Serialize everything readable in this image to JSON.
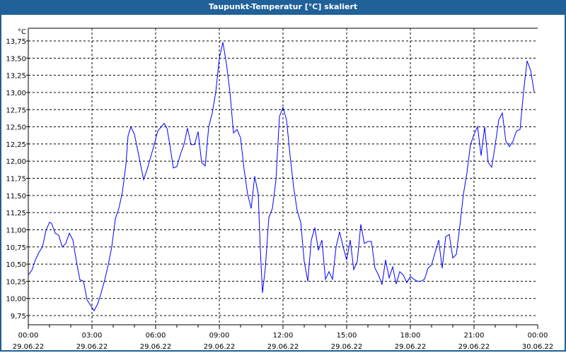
{
  "window": {
    "title": "Taupunkt-Temperatur [°C] skaliert"
  },
  "chart_data": {
    "type": "line",
    "title": "Taupunkt-Temperatur [°C] skaliert",
    "ylabel": "°C",
    "xlabel": "",
    "ylim": [
      9.625,
      13.9
    ],
    "xlim_minutes": [
      0,
      1440
    ],
    "grid": true,
    "line_color": "#0000ff",
    "yticks": [
      {
        "value": 9.75,
        "label": "9,75"
      },
      {
        "value": 10.0,
        "label": "10,00"
      },
      {
        "value": 10.25,
        "label": "10,25"
      },
      {
        "value": 10.5,
        "label": "10,50"
      },
      {
        "value": 10.75,
        "label": "10,75"
      },
      {
        "value": 11.0,
        "label": "11,00"
      },
      {
        "value": 11.25,
        "label": "11,25"
      },
      {
        "value": 11.5,
        "label": "11,50"
      },
      {
        "value": 11.75,
        "label": "11,75"
      },
      {
        "value": 12.0,
        "label": "12,00"
      },
      {
        "value": 12.25,
        "label": "12,25"
      },
      {
        "value": 12.5,
        "label": "12,50"
      },
      {
        "value": 12.75,
        "label": "12,75"
      },
      {
        "value": 13.0,
        "label": "13,00"
      },
      {
        "value": 13.25,
        "label": "13,25"
      },
      {
        "value": 13.5,
        "label": "13,50"
      },
      {
        "value": 13.75,
        "label": "13,75"
      }
    ],
    "xticks": [
      {
        "minutes": 0,
        "time": "00:00",
        "date": "29.06.22"
      },
      {
        "minutes": 180,
        "time": "03:00",
        "date": "29.06.22"
      },
      {
        "minutes": 360,
        "time": "06:00",
        "date": "29.06.22"
      },
      {
        "minutes": 540,
        "time": "09:00",
        "date": "29.06.22"
      },
      {
        "minutes": 720,
        "time": "12:00",
        "date": "29.06.22"
      },
      {
        "minutes": 900,
        "time": "15:00",
        "date": "29.06.22"
      },
      {
        "minutes": 1080,
        "time": "18:00",
        "date": "29.06.22"
      },
      {
        "minutes": 1260,
        "time": "21:00",
        "date": "29.06.22"
      },
      {
        "minutes": 1440,
        "time": "00:00",
        "date": "30.06.22"
      }
    ],
    "series": [
      {
        "name": "Taupunkt",
        "points": [
          [
            0,
            10.34
          ],
          [
            10,
            10.41
          ],
          [
            20,
            10.56
          ],
          [
            30,
            10.67
          ],
          [
            40,
            10.75
          ],
          [
            50,
            10.99
          ],
          [
            60,
            11.11
          ],
          [
            66,
            11.09
          ],
          [
            76,
            10.95
          ],
          [
            86,
            10.92
          ],
          [
            96,
            10.75
          ],
          [
            106,
            10.8
          ],
          [
            116,
            10.95
          ],
          [
            126,
            10.85
          ],
          [
            136,
            10.54
          ],
          [
            146,
            10.27
          ],
          [
            156,
            10.25
          ],
          [
            166,
            9.98
          ],
          [
            176,
            9.9
          ],
          [
            186,
            9.82
          ],
          [
            196,
            9.92
          ],
          [
            206,
            10.08
          ],
          [
            216,
            10.27
          ],
          [
            226,
            10.49
          ],
          [
            236,
            10.75
          ],
          [
            246,
            11.16
          ],
          [
            256,
            11.31
          ],
          [
            266,
            11.55
          ],
          [
            276,
            11.95
          ],
          [
            282,
            12.37
          ],
          [
            290,
            12.5
          ],
          [
            300,
            12.39
          ],
          [
            310,
            12.14
          ],
          [
            320,
            11.88
          ],
          [
            326,
            11.73
          ],
          [
            336,
            11.88
          ],
          [
            346,
            12.06
          ],
          [
            356,
            12.24
          ],
          [
            366,
            12.44
          ],
          [
            376,
            12.5
          ],
          [
            384,
            12.55
          ],
          [
            392,
            12.48
          ],
          [
            400,
            12.24
          ],
          [
            410,
            11.9
          ],
          [
            420,
            11.92
          ],
          [
            430,
            12.1
          ],
          [
            440,
            12.24
          ],
          [
            450,
            12.48
          ],
          [
            460,
            12.24
          ],
          [
            470,
            12.24
          ],
          [
            480,
            12.43
          ],
          [
            490,
            11.98
          ],
          [
            500,
            11.93
          ],
          [
            510,
            12.5
          ],
          [
            520,
            12.7
          ],
          [
            530,
            13.01
          ],
          [
            540,
            13.5
          ],
          [
            550,
            13.73
          ],
          [
            560,
            13.42
          ],
          [
            570,
            13.01
          ],
          [
            580,
            12.41
          ],
          [
            590,
            12.46
          ],
          [
            600,
            12.34
          ],
          [
            610,
            11.88
          ],
          [
            620,
            11.52
          ],
          [
            630,
            11.31
          ],
          [
            640,
            11.78
          ],
          [
            650,
            11.52
          ],
          [
            656,
            10.7
          ],
          [
            662,
            10.08
          ],
          [
            670,
            10.44
          ],
          [
            680,
            11.18
          ],
          [
            690,
            11.31
          ],
          [
            700,
            11.72
          ],
          [
            710,
            12.65
          ],
          [
            720,
            12.78
          ],
          [
            730,
            12.6
          ],
          [
            740,
            12.08
          ],
          [
            750,
            11.62
          ],
          [
            760,
            11.28
          ],
          [
            770,
            11.11
          ],
          [
            780,
            10.54
          ],
          [
            790,
            10.25
          ],
          [
            800,
            10.85
          ],
          [
            810,
            11.03
          ],
          [
            820,
            10.7
          ],
          [
            830,
            10.85
          ],
          [
            840,
            10.28
          ],
          [
            850,
            10.39
          ],
          [
            860,
            10.28
          ],
          [
            870,
            10.75
          ],
          [
            880,
            10.97
          ],
          [
            890,
            10.75
          ],
          [
            900,
            10.56
          ],
          [
            910,
            10.85
          ],
          [
            920,
            10.42
          ],
          [
            930,
            10.54
          ],
          [
            940,
            11.08
          ],
          [
            950,
            10.8
          ],
          [
            960,
            10.83
          ],
          [
            970,
            10.83
          ],
          [
            980,
            10.44
          ],
          [
            990,
            10.34
          ],
          [
            1000,
            10.2
          ],
          [
            1010,
            10.56
          ],
          [
            1020,
            10.3
          ],
          [
            1030,
            10.46
          ],
          [
            1040,
            10.21
          ],
          [
            1050,
            10.39
          ],
          [
            1060,
            10.34
          ],
          [
            1070,
            10.23
          ],
          [
            1080,
            10.32
          ],
          [
            1090,
            10.28
          ],
          [
            1100,
            10.25
          ],
          [
            1110,
            10.25
          ],
          [
            1120,
            10.28
          ],
          [
            1130,
            10.44
          ],
          [
            1140,
            10.49
          ],
          [
            1150,
            10.67
          ],
          [
            1160,
            10.85
          ],
          [
            1170,
            10.44
          ],
          [
            1180,
            10.9
          ],
          [
            1190,
            10.93
          ],
          [
            1200,
            10.59
          ],
          [
            1210,
            10.64
          ],
          [
            1220,
            11.06
          ],
          [
            1230,
            11.52
          ],
          [
            1240,
            11.83
          ],
          [
            1250,
            12.24
          ],
          [
            1260,
            12.39
          ],
          [
            1270,
            12.5
          ],
          [
            1280,
            12.08
          ],
          [
            1290,
            12.5
          ],
          [
            1300,
            11.98
          ],
          [
            1310,
            11.91
          ],
          [
            1320,
            12.24
          ],
          [
            1330,
            12.6
          ],
          [
            1340,
            12.7
          ],
          [
            1350,
            12.29
          ],
          [
            1360,
            12.21
          ],
          [
            1370,
            12.29
          ],
          [
            1380,
            12.44
          ],
          [
            1390,
            12.46
          ],
          [
            1400,
            13.01
          ],
          [
            1410,
            13.46
          ],
          [
            1420,
            13.32
          ],
          [
            1430,
            13.01
          ]
        ]
      }
    ]
  }
}
